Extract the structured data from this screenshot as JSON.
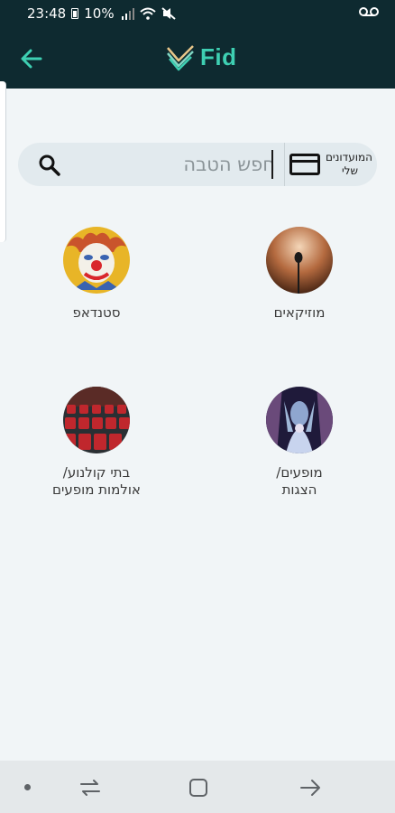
{
  "status_bar": {
    "time": "23:48",
    "battery": "10%",
    "icons": [
      "battery-icon",
      "signal-icon",
      "wifi-icon",
      "mute-icon",
      "voicemail-icon"
    ]
  },
  "app_bar": {
    "logo_text": "Fid",
    "back_icon": "arrow-left-icon"
  },
  "search": {
    "placeholder": "חפש הטבה",
    "value": "",
    "clubs_button_label_line1": "המועדונים",
    "clubs_button_label_line2": "שלי"
  },
  "categories": [
    {
      "label_line1": "מוזיקאים",
      "label_line2": ""
    },
    {
      "label_line1": "סטנדאפ",
      "label_line2": ""
    },
    {
      "label_line1": "מופעים/",
      "label_line2": "הצגות"
    },
    {
      "label_line1": "בתי קולנוע/",
      "label_line2": "אולמות מופעים"
    }
  ],
  "nav_bar": {
    "icons": [
      "dot-icon",
      "recent-apps-icon",
      "home-icon",
      "back-icon"
    ]
  },
  "colors": {
    "app_bar_bg": "#0e2a30",
    "accent": "#3ecfb2",
    "page_bg": "#f1f5f7",
    "search_bg": "#e2eaee"
  }
}
